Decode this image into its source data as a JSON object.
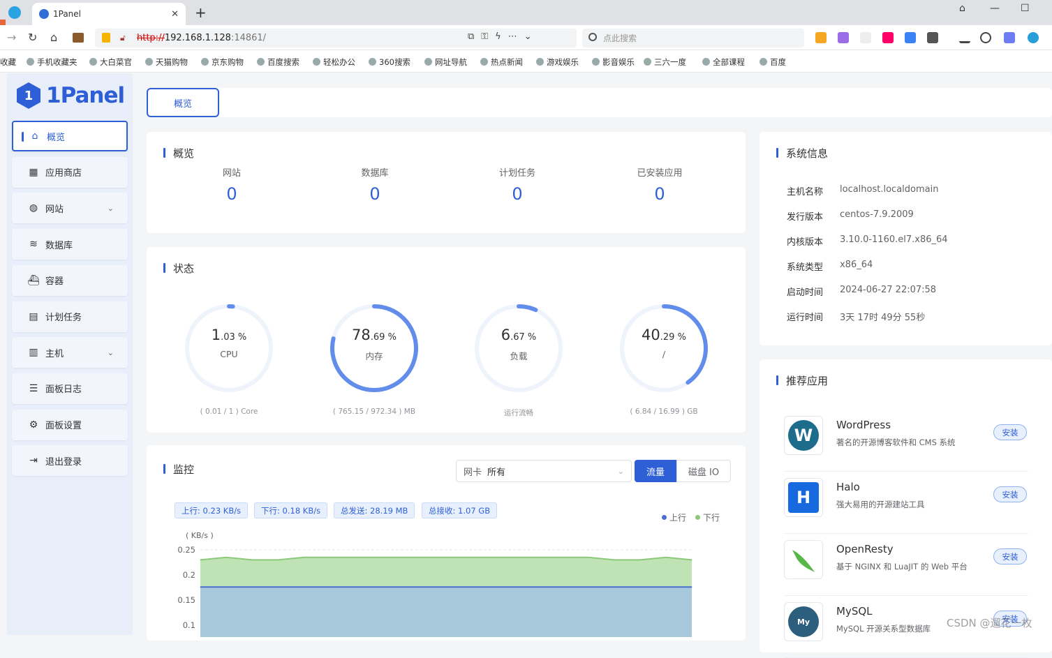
{
  "browser": {
    "tab_title": "1Panel",
    "url_protocol": "http://",
    "url_host": "192.168.1.128",
    "url_port": ":14861/",
    "search_placeholder": "点此搜索",
    "bookmarks": [
      "收藏",
      "手机收藏夹",
      "大白菜官",
      "天猫购物",
      "京东购物",
      "百度搜索",
      "轻松办公",
      "360搜索",
      "网址导航",
      "热点新闻",
      "游戏娱乐",
      "影音娱乐",
      "三六一度",
      "全部课程",
      "百度"
    ]
  },
  "sidebar": {
    "logo_text": "1Panel",
    "items": [
      {
        "label": "概览",
        "icon": "home-icon"
      },
      {
        "label": "应用商店",
        "icon": "grid-icon"
      },
      {
        "label": "网站",
        "icon": "globe-icon"
      },
      {
        "label": "数据库",
        "icon": "layers-icon"
      },
      {
        "label": "容器",
        "icon": "docker-icon"
      },
      {
        "label": "计划任务",
        "icon": "calendar-icon"
      },
      {
        "label": "主机",
        "icon": "server-icon"
      },
      {
        "label": "面板日志",
        "icon": "log-icon"
      },
      {
        "label": "面板设置",
        "icon": "gear-icon"
      },
      {
        "label": "退出登录",
        "icon": "logout-icon"
      }
    ]
  },
  "top_tab": "概览",
  "overview": {
    "title": "概览",
    "items": [
      {
        "label": "网站",
        "value": "0"
      },
      {
        "label": "数据库",
        "value": "0"
      },
      {
        "label": "计划任务",
        "value": "0"
      },
      {
        "label": "已安装应用",
        "value": "0"
      }
    ]
  },
  "status": {
    "title": "状态",
    "gauges": [
      {
        "int": "1",
        "dec": ".03",
        "unit": " %",
        "name": "CPU",
        "foot": "( 0.01 / 1 ) Core",
        "percent": 1.03
      },
      {
        "int": "78",
        "dec": ".69",
        "unit": " %",
        "name": "内存",
        "foot": "( 765.15 / 972.34 ) MB",
        "percent": 78.69
      },
      {
        "int": "6",
        "dec": ".67",
        "unit": " %",
        "name": "负载",
        "foot": "运行流畅",
        "percent": 6.67
      },
      {
        "int": "40",
        "dec": ".29",
        "unit": " %",
        "name": "/",
        "foot": "( 6.84 / 16.99 ) GB",
        "percent": 40.29
      }
    ]
  },
  "monitor": {
    "title": "监控",
    "nic_label": "网卡",
    "nic_value": "所有",
    "btn_traffic": "流量",
    "btn_disk": "磁盘 IO",
    "tags": [
      "上行: 0.23 KB/s",
      "下行: 0.18 KB/s",
      "总发送: 28.19 MB",
      "总接收: 1.07 GB"
    ],
    "legend": {
      "up": "上行",
      "down": "下行"
    },
    "colors": {
      "up": "#4a6fd0",
      "down": "#8cc87a"
    }
  },
  "chart_data": {
    "type": "area",
    "ylabel": "( KB/s )",
    "yticks": [
      "0.25",
      "0.2",
      "0.15",
      "0.1"
    ],
    "ylim": [
      0.1,
      0.25
    ],
    "series": [
      {
        "name": "上行",
        "values": [
          0.176,
          0.176,
          0.176,
          0.176,
          0.176,
          0.176,
          0.176,
          0.176,
          0.176,
          0.176,
          0.176,
          0.176,
          0.176,
          0.176,
          0.176,
          0.176,
          0.176,
          0.176,
          0.176,
          0.176
        ]
      },
      {
        "name": "下行",
        "values": [
          0.23,
          0.235,
          0.23,
          0.23,
          0.235,
          0.235,
          0.235,
          0.235,
          0.235,
          0.235,
          0.235,
          0.235,
          0.235,
          0.235,
          0.235,
          0.235,
          0.23,
          0.23,
          0.235,
          0.23
        ]
      }
    ]
  },
  "sysinfo": {
    "title": "系统信息",
    "rows": [
      {
        "k": "主机名称",
        "v": "localhost.localdomain"
      },
      {
        "k": "发行版本",
        "v": "centos-7.9.2009"
      },
      {
        "k": "内核版本",
        "v": "3.10.0-1160.el7.x86_64"
      },
      {
        "k": "系统类型",
        "v": "x86_64"
      },
      {
        "k": "启动时间",
        "v": "2024-06-27 22:07:58"
      },
      {
        "k": "运行时间",
        "v": "3天 17时 49分 55秒"
      }
    ]
  },
  "recommend": {
    "title": "推荐应用",
    "apps": [
      {
        "name": "WordPress",
        "desc": "著名的开源博客软件和 CMS 系统",
        "btn": "安装"
      },
      {
        "name": "Halo",
        "desc": "强大易用的开源建站工具",
        "btn": "安装"
      },
      {
        "name": "OpenResty",
        "desc": "基于 NGINX 和 LuaJIT 的 Web 平台",
        "btn": "安装"
      },
      {
        "name": "MySQL",
        "desc": "MySQL 开源关系型数据库",
        "btn": "安装"
      }
    ]
  },
  "watermark": "CSDN @遛花一枚"
}
